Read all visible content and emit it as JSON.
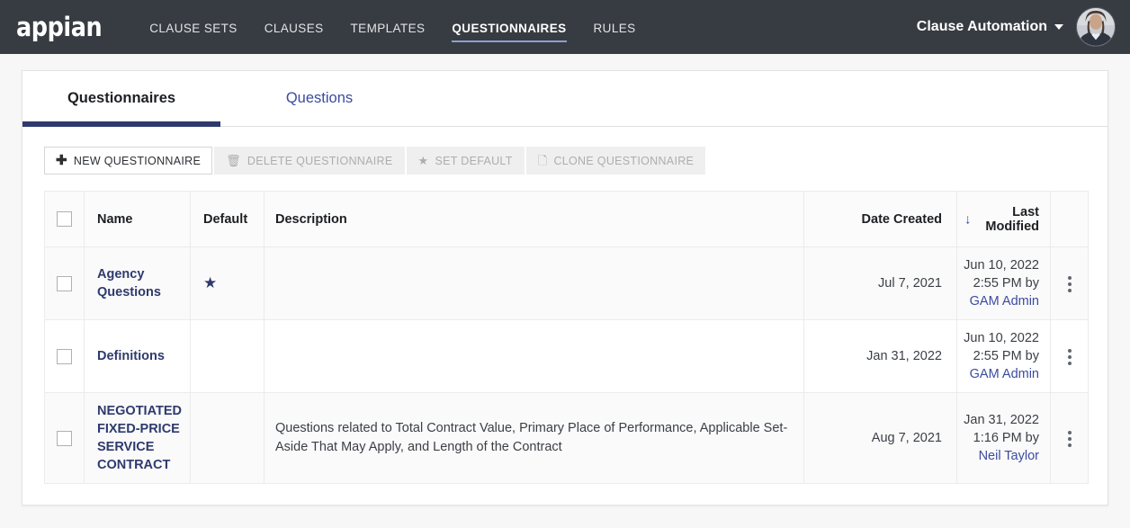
{
  "header": {
    "logo_text": "appian",
    "nav_items": [
      {
        "label": "CLAUSE SETS",
        "active": false
      },
      {
        "label": "CLAUSES",
        "active": false
      },
      {
        "label": "TEMPLATES",
        "active": false
      },
      {
        "label": "QUESTIONNAIRES",
        "active": true
      },
      {
        "label": "RULES",
        "active": false
      }
    ],
    "user_menu_label": "Clause Automation",
    "caret_icon": "chevron-down-icon",
    "avatar_icon": "user-avatar-photo",
    "background_color": "#373c42",
    "active_underline_color": "#8e9dd4"
  },
  "tabs": [
    {
      "label": "Questionnaires",
      "active": true
    },
    {
      "label": "Questions",
      "active": false
    }
  ],
  "toolbar": {
    "new_label": "NEW QUESTIONNAIRE",
    "new_icon": "plus-icon",
    "delete_label": "DELETE QUESTIONNAIRE",
    "delete_icon": "trash-icon",
    "set_default_label": "SET DEFAULT",
    "set_default_icon": "star-icon",
    "clone_label": "CLONE QUESTIONNAIRE",
    "clone_icon": "copy-icon"
  },
  "table": {
    "columns": {
      "select_all": "",
      "name": "Name",
      "default": "Default",
      "description": "Description",
      "date_created": "Date Created",
      "last_modified": "Last Modified"
    },
    "sort": {
      "column": "Last Modified",
      "direction": "descending",
      "icon": "arrow-down-icon",
      "color": "#3b4ba0"
    },
    "rows": [
      {
        "name": "Agency Questions",
        "is_default": true,
        "default_icon": "star-filled-icon",
        "description": "",
        "date_created": "Jul 7, 2021",
        "modified_date": "Jun 10, 2022",
        "modified_time": "2:55 PM by",
        "modified_user": "GAM Admin",
        "uppercase_name": false
      },
      {
        "name": "Definitions",
        "is_default": false,
        "default_icon": "",
        "description": "",
        "date_created": "Jan 31, 2022",
        "modified_date": "Jun 10, 2022",
        "modified_time": "2:55 PM by",
        "modified_user": "GAM Admin",
        "uppercase_name": false
      },
      {
        "name": "NEGOTIATED FIXED-PRICE SERVICE CONTRACT",
        "is_default": false,
        "default_icon": "",
        "description": "Questions related to Total Contract Value, Primary Place of Performance, Applicable Set-Aside That May Apply, and Length of the Contract",
        "date_created": "Aug 7, 2021",
        "modified_date": "Jan 31, 2022",
        "modified_time": "1:16 PM by",
        "modified_user": "Neil Taylor",
        "uppercase_name": true
      }
    ],
    "row_menu_icon": "kebab-menu-icon",
    "checkbox_icon": "checkbox-unchecked-icon"
  },
  "colors": {
    "navy": "#2e3a6e",
    "link": "#3b4ba0",
    "page_background": "#f7f7f7"
  }
}
